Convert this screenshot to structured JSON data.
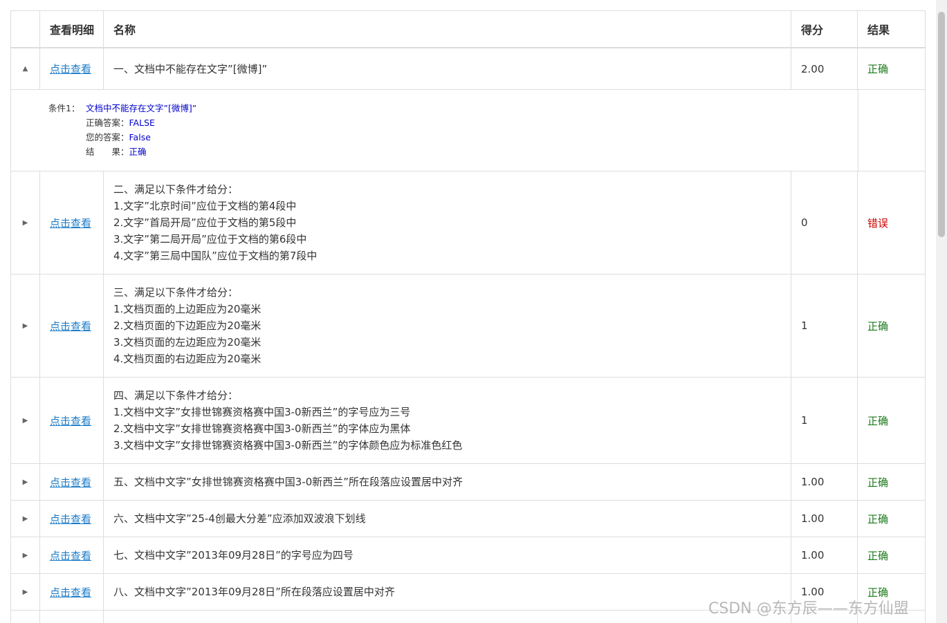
{
  "header": {
    "detail": "查看明细",
    "name": "名称",
    "score": "得分",
    "result": "结果"
  },
  "rows": [
    {
      "toggle": "▲",
      "link": "点击查看",
      "name_lines": [
        "一、文档中不能存在文字”[微博]”"
      ],
      "score": "2.00",
      "result": "正确",
      "expanded": true
    },
    {
      "toggle": "▶",
      "link": "点击查看",
      "name_lines": [
        "二、满足以下条件才给分：",
        "1.文字”北京时间”应位于文档的第4段中",
        "2.文字”首局开局”应位于文档的第5段中",
        "3.文字”第二局开局”应位于文档的第6段中",
        "4.文字”第三局中国队”应位于文档的第7段中"
      ],
      "score": "0",
      "result": "错误"
    },
    {
      "toggle": "▶",
      "link": "点击查看",
      "name_lines": [
        "三、满足以下条件才给分：",
        "1.文档页面的上边距应为20毫米",
        "2.文档页面的下边距应为20毫米",
        "3.文档页面的左边距应为20毫米",
        "4.文档页面的右边距应为20毫米"
      ],
      "score": "1",
      "result": "正确"
    },
    {
      "toggle": "▶",
      "link": "点击查看",
      "name_lines": [
        "四、满足以下条件才给分：",
        "1.文档中文字”女排世锦赛资格赛中国3-0新西兰”的字号应为三号",
        "2.文档中文字”女排世锦赛资格赛中国3-0新西兰”的字体应为黑体",
        "3.文档中文字”女排世锦赛资格赛中国3-0新西兰”的字体颜色应为标准色红色"
      ],
      "score": "1",
      "result": "正确"
    },
    {
      "toggle": "▶",
      "link": "点击查看",
      "name_lines": [
        "五、文档中文字”女排世锦赛资格赛中国3-0新西兰”所在段落应设置居中对齐"
      ],
      "score": "1.00",
      "result": "正确"
    },
    {
      "toggle": "▶",
      "link": "点击查看",
      "name_lines": [
        "六、文档中文字”25-4创最大分差”应添加双波浪下划线"
      ],
      "score": "1.00",
      "result": "正确"
    },
    {
      "toggle": "▶",
      "link": "点击查看",
      "name_lines": [
        "七、文档中文字”2013年09月28日”的字号应为四号"
      ],
      "score": "1.00",
      "result": "正确"
    },
    {
      "toggle": "▶",
      "link": "点击查看",
      "name_lines": [
        "八、文档中文字”2013年09月28日”所在段落应设置居中对齐"
      ],
      "score": "1.00",
      "result": "正确"
    }
  ],
  "detail_panel": {
    "cond_label": "条件1：",
    "cond_text": "文档中不能存在文字”[微博]”",
    "correct_label": "正确答案：",
    "correct_value": "FALSE",
    "your_label": "您的答案：",
    "your_value": "False",
    "result_label": "结　　果：",
    "result_value": "正确"
  },
  "watermark": "CSDN @东方辰——东方仙盟",
  "colors": {
    "link": "#1a7bc8",
    "ok": "#1b7a1b",
    "bad": "#cc0000",
    "detail_value": "#0000cc",
    "border": "#dddddd"
  }
}
